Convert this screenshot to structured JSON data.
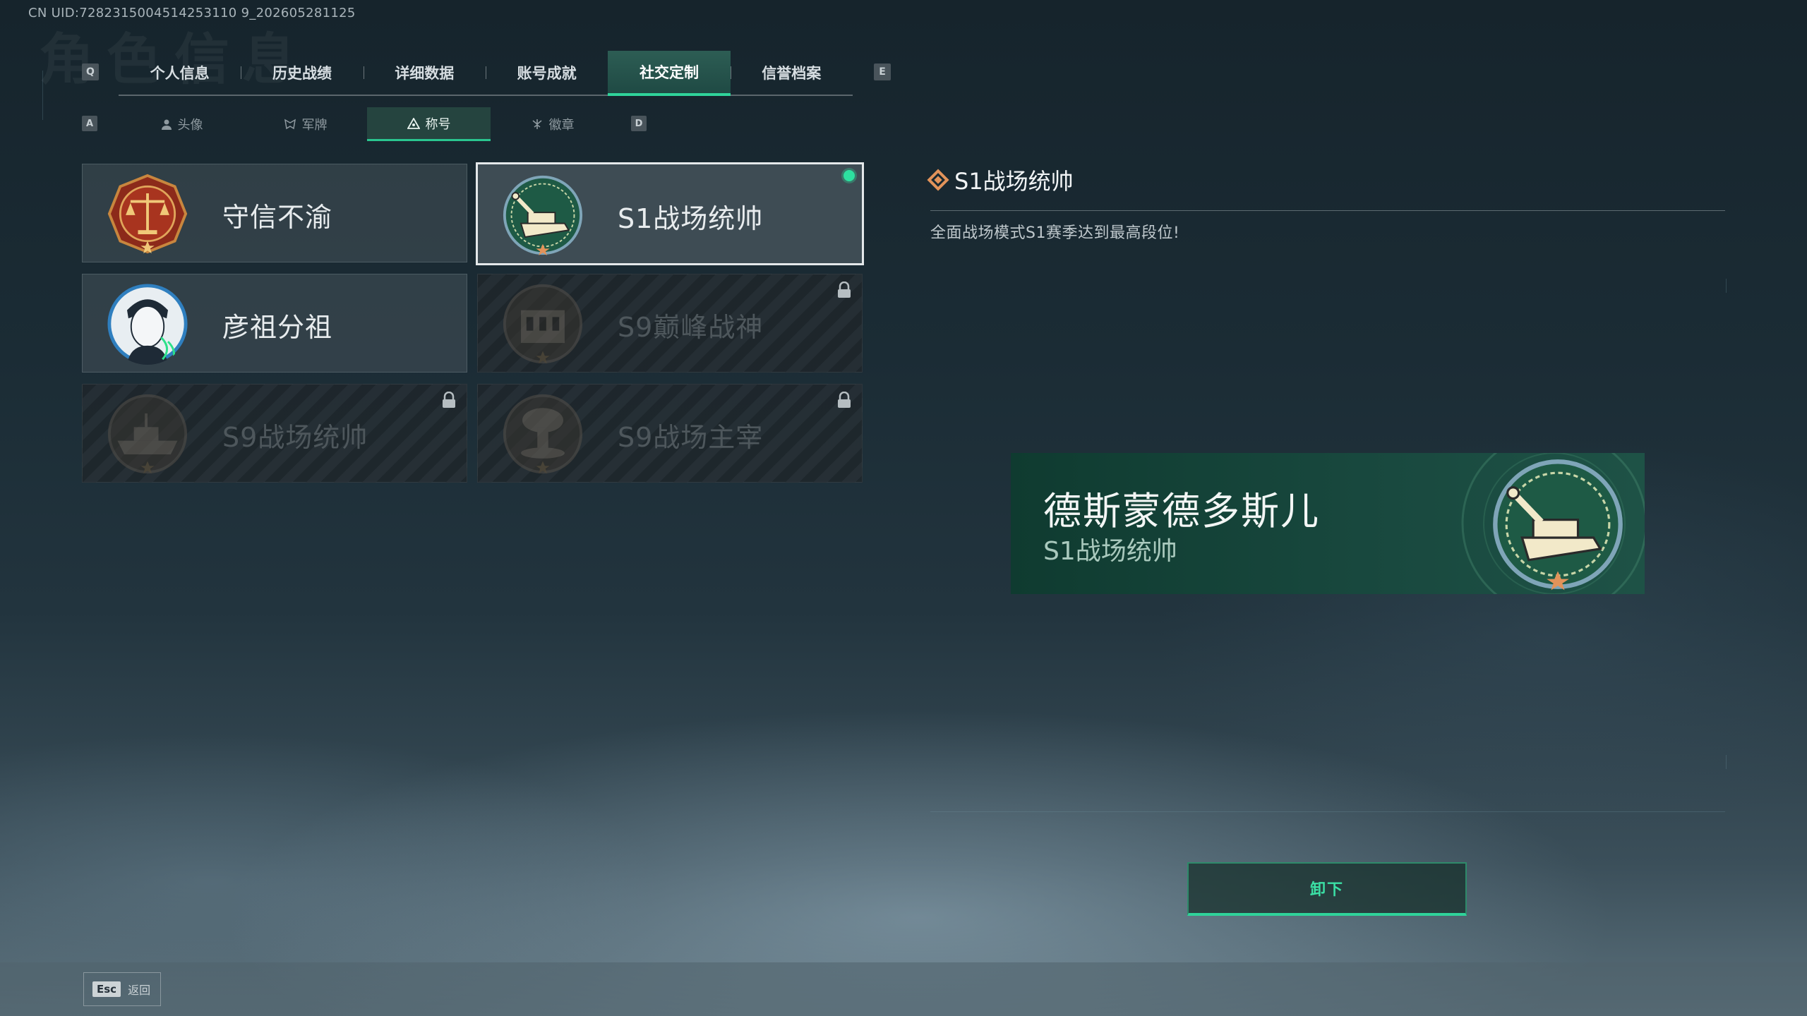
{
  "uid": "CN UID:7282315004514253110 9_202605281125",
  "ghost_title": "角色信息",
  "keys": {
    "prev_tab": "Q",
    "next_tab": "E",
    "prev_sub": "A",
    "next_sub": "D"
  },
  "tabs": [
    {
      "label": "个人信息"
    },
    {
      "label": "历史战绩"
    },
    {
      "label": "详细数据"
    },
    {
      "label": "账号成就"
    },
    {
      "label": "社交定制",
      "active": true
    },
    {
      "label": "信誉档案"
    }
  ],
  "subtabs": [
    {
      "label": "头像",
      "icon": "person-icon"
    },
    {
      "label": "军牌",
      "icon": "dogtag-icon"
    },
    {
      "label": "称号",
      "icon": "title-icon",
      "active": true
    },
    {
      "label": "徽章",
      "icon": "badge-icon"
    }
  ],
  "cards": [
    {
      "name": "守信不渝",
      "emblem": "scales-emblem",
      "state": "unlocked"
    },
    {
      "name": "S1战场统帅",
      "emblem": "tank-emblem",
      "state": "selected"
    },
    {
      "name": "彦祖分祖",
      "emblem": "portrait-emblem",
      "state": "unlocked"
    },
    {
      "name": "S9巅峰战神",
      "emblem": "fortress-emblem",
      "state": "locked"
    },
    {
      "name": "S9战场统帅",
      "emblem": "battleship-emblem",
      "state": "locked"
    },
    {
      "name": "S9战场主宰",
      "emblem": "mushroom-cloud-emblem",
      "state": "locked"
    }
  ],
  "detail": {
    "title": "S1战场统帅",
    "description": "全面战场模式S1赛季达到最高段位!"
  },
  "preview": {
    "player_name": "德斯蒙德多斯儿",
    "title": "S1战场统帅"
  },
  "unequip_label": "卸下",
  "footer": {
    "esc_key": "Esc",
    "back_label": "返回"
  },
  "colors": {
    "accent": "#2fd39a",
    "selected_dot": "#2de0a0",
    "banner": "#19493f",
    "diamond": "#e2935a"
  }
}
